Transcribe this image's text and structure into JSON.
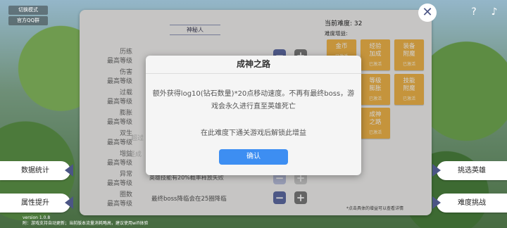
{
  "top_left": {
    "switch_mode": "切换模式",
    "qq_group": "官方QQ群"
  },
  "panel": {
    "tab_label": "神秘人",
    "stats": [
      {
        "name": "历练",
        "sub": "最高等级"
      },
      {
        "name": "伤害",
        "sub": "最高等级"
      },
      {
        "name": "过载",
        "sub": "最高等级"
      },
      {
        "name": "膨胀",
        "sub": "最高等级"
      },
      {
        "name": "双生",
        "sub": "最高等级"
      },
      {
        "name": "增益",
        "sub": "最高等级"
      },
      {
        "name": "异常",
        "sub": "最高等级"
      },
      {
        "name": "圈数",
        "sub": "最高等级"
      }
    ],
    "greyed_1": "超过",
    "greyed_2": "野怪成",
    "item_hero_skill": "英雄技能有20%概率释放失败",
    "item_boss": "最终boss降临会在25圈降临"
  },
  "right_panel": {
    "difficulty_label": "当前难度: 32",
    "boost_label": "难度增益:",
    "boosts": [
      {
        "name": "金币",
        "status": "已激活"
      },
      {
        "name": "经验\n加成",
        "status": "已激活"
      },
      {
        "name": "装备\n附魔",
        "status": "已激活"
      },
      {
        "name": "等级\n膨胀",
        "status": "已激活"
      },
      {
        "name": "技能\n附魔",
        "status": "已激活"
      },
      {
        "name": "成神\n之路",
        "status": "已激活"
      }
    ],
    "footnote": "*点击具体的增益可以查看详情"
  },
  "modal": {
    "title": "成神之路",
    "body": "额外获得log10(钻石数量)*20点移动速度。不再有最终boss，游戏会永久进行直至英雄死亡",
    "note": "在此难度下通关游戏后解锁此增益",
    "confirm": "确认"
  },
  "side_buttons": {
    "data_stats": "数据统计",
    "attr_upgrade": "属性提升",
    "challenge_hero": "挑选英雄",
    "difficulty_challenge": "难度挑战"
  },
  "footer": {
    "version": "version 1.0.8",
    "notice": "附：游戏支持自动更新；当前版本流量消耗略高，建议使用wifi体验"
  },
  "colors": {
    "accent": "#3d8ef2",
    "boost": "#f1b54a",
    "nav": "#4b5585"
  }
}
